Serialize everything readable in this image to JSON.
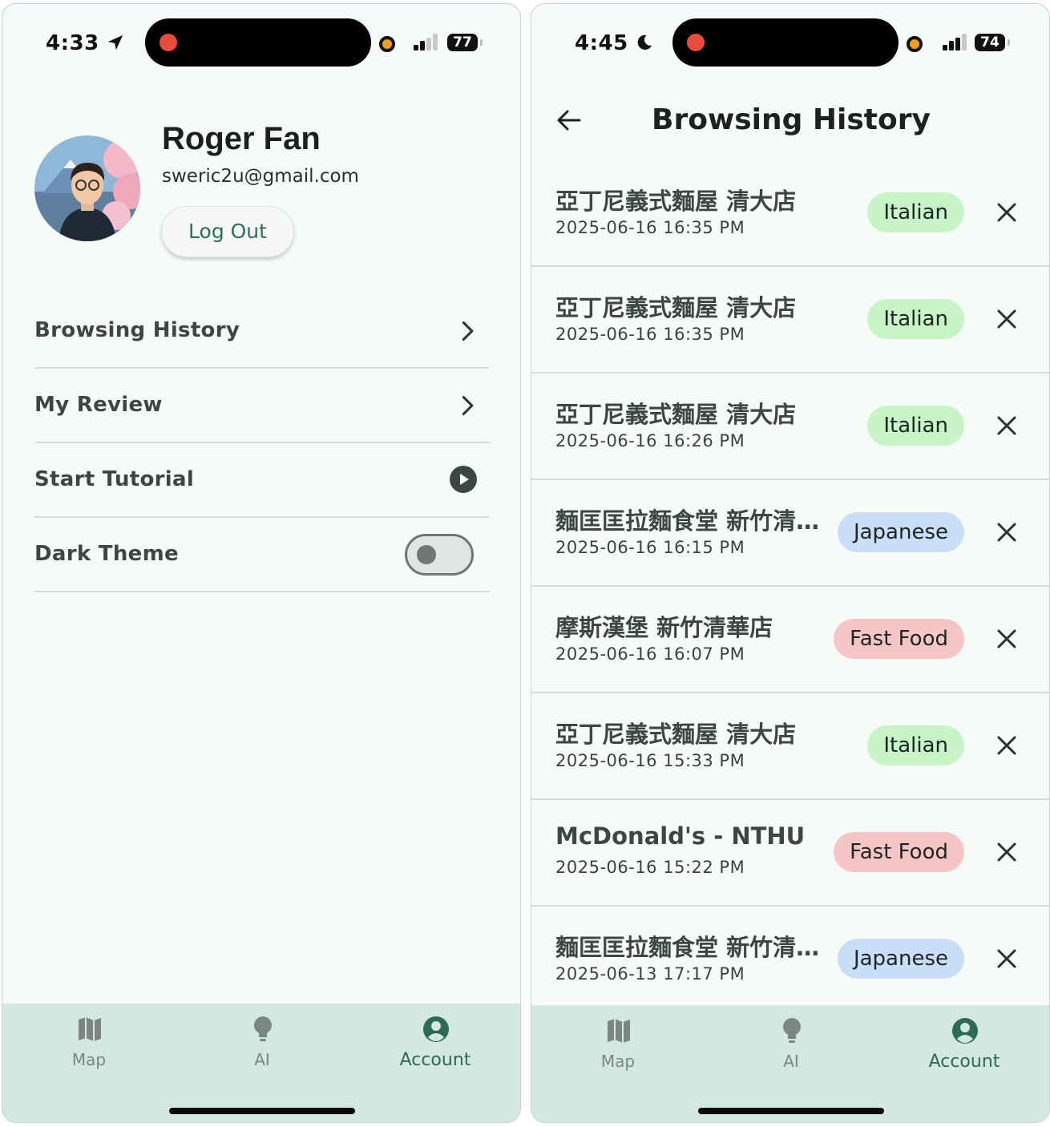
{
  "left_screen": {
    "status": {
      "time": "4:33",
      "battery": "77"
    },
    "profile": {
      "name": "Roger Fan",
      "email": "sweric2u@gmail.com",
      "logout_label": "Log Out"
    },
    "menu": [
      {
        "label": "Browsing History",
        "icon": "chevron-right-icon"
      },
      {
        "label": "My Review",
        "icon": "chevron-right-icon"
      },
      {
        "label": "Start Tutorial",
        "icon": "play-circle-icon"
      },
      {
        "label": "Dark Theme",
        "toggle_on": false
      }
    ]
  },
  "right_screen": {
    "status": {
      "time": "4:45",
      "battery": "74"
    },
    "title": "Browsing History",
    "history": [
      {
        "name": "亞丁尼義式麵屋 清大店",
        "date": "2025-06-16 16:35 PM",
        "tag": "Italian",
        "tag_color": "#c8f5c8"
      },
      {
        "name": "亞丁尼義式麵屋 清大店",
        "date": "2025-06-16 16:35 PM",
        "tag": "Italian",
        "tag_color": "#c8f5c8"
      },
      {
        "name": "亞丁尼義式麵屋 清大店",
        "date": "2025-06-16 16:26 PM",
        "tag": "Italian",
        "tag_color": "#c8f5c8"
      },
      {
        "name": "麵匡匡拉麵食堂 新竹清…",
        "date": "2025-06-16 16:15 PM",
        "tag": "Japanese",
        "tag_color": "#c9def8"
      },
      {
        "name": "摩斯漢堡 新竹清華店",
        "date": "2025-06-16 16:07 PM",
        "tag": "Fast Food",
        "tag_color": "#f6c6c6"
      },
      {
        "name": "亞丁尼義式麵屋 清大店",
        "date": "2025-06-16 15:33 PM",
        "tag": "Italian",
        "tag_color": "#c8f5c8"
      },
      {
        "name": "McDonald's - NTHU",
        "date": "2025-06-16 15:22 PM",
        "tag": "Fast Food",
        "tag_color": "#f6c6c6"
      },
      {
        "name": "麵匡匡拉麵食堂 新竹清…",
        "date": "2025-06-13 17:17 PM",
        "tag": "Japanese",
        "tag_color": "#c9def8"
      }
    ]
  },
  "tabs": [
    {
      "label": "Map",
      "icon": "map-icon"
    },
    {
      "label": "AI",
      "icon": "lightbulb-icon"
    },
    {
      "label": "Account",
      "icon": "account-icon",
      "active": true
    }
  ],
  "colors": {
    "accent": "#2e6b54",
    "background": "#f6fbf8",
    "tabbar": "#d3e8df"
  }
}
